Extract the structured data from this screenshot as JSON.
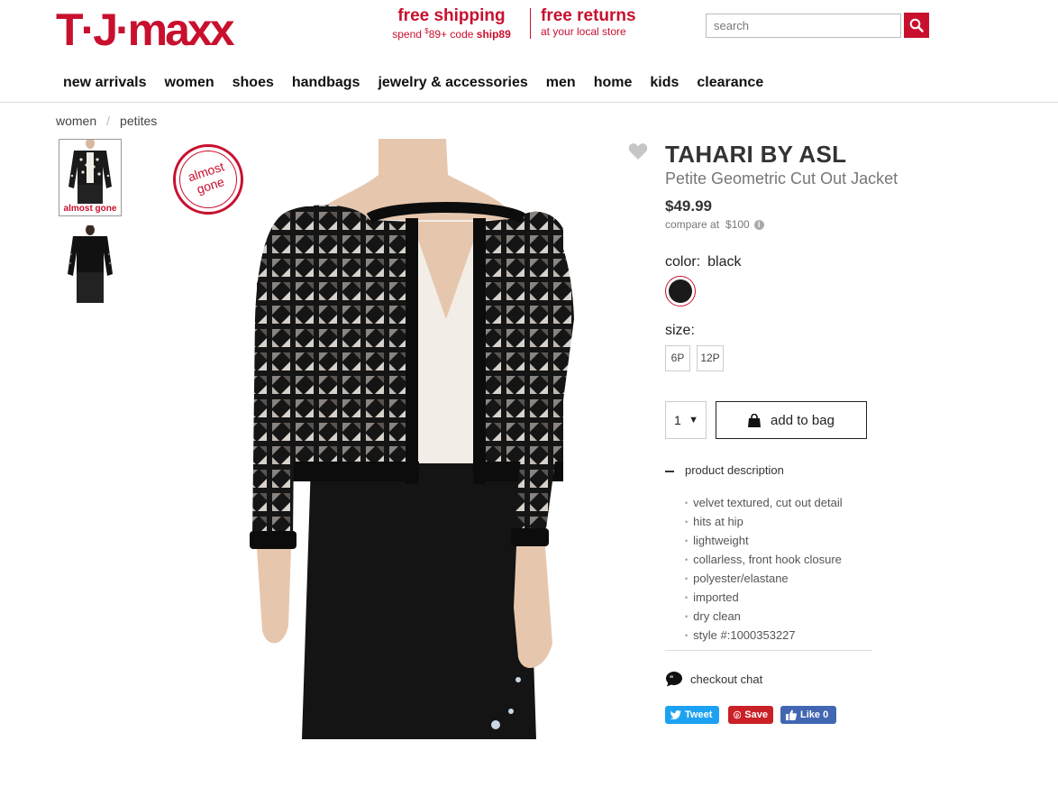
{
  "header": {
    "logo_text": "T·J·maxx",
    "promo_shipping": {
      "title": "free shipping",
      "line_prefix": "spend ",
      "amount_sup": "$",
      "amount": "89+",
      "code_prefix": " code ",
      "code": "ship89"
    },
    "promo_returns": {
      "title": "free returns",
      "line": "at your local store"
    },
    "search_placeholder": "search"
  },
  "nav": [
    "new arrivals",
    "women",
    "shoes",
    "handbags",
    "jewelry & accessories",
    "men",
    "home",
    "kids",
    "clearance"
  ],
  "breadcrumb": {
    "items": [
      "women",
      "petites"
    ],
    "separator": "/"
  },
  "gallery": {
    "thumb_badge": "almost gone",
    "badge_text": "almost gone"
  },
  "product": {
    "brand": "TAHARI BY ASL",
    "name": "Petite Geometric Cut Out Jacket",
    "price": "$49.99",
    "compare_label": "compare at",
    "compare_price": "$100",
    "color_label": "color:",
    "color_value": "black",
    "size_label": "size:",
    "sizes": [
      "6P",
      "12P"
    ],
    "quantity": "1",
    "add_to_bag": "add to bag",
    "description_label": "product description",
    "description": [
      "velvet textured, cut out detail",
      "hits at hip",
      "lightweight",
      "collarless, front hook closure",
      "polyester/elastane",
      "imported",
      "dry clean",
      "style #:1000353227"
    ],
    "chat_label": "checkout chat"
  },
  "social": {
    "tweet": "Tweet",
    "save": "Save",
    "like": "Like 0"
  },
  "colors": {
    "brand_red": "#c8102e",
    "twitter": "#1da1f2",
    "pinterest": "#cb2027",
    "facebook": "#4267b2"
  }
}
